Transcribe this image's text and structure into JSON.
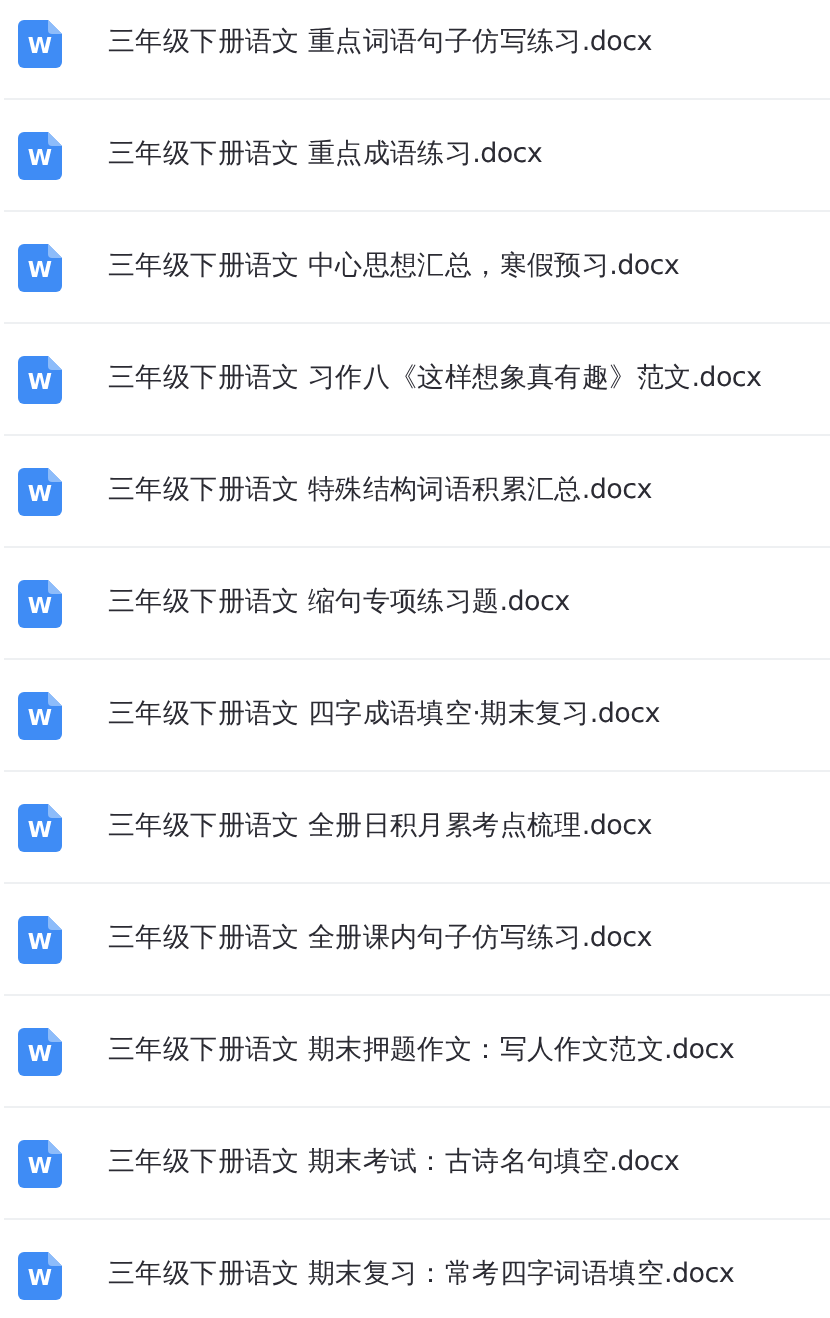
{
  "files": [
    {
      "icon_label": "W",
      "name": "三年级下册语文 重点词语句子仿写练习.docx"
    },
    {
      "icon_label": "W",
      "name": "三年级下册语文 重点成语练习.docx"
    },
    {
      "icon_label": "W",
      "name": "三年级下册语文 中心思想汇总，寒假预习.docx"
    },
    {
      "icon_label": "W",
      "name": "三年级下册语文 习作八《这样想象真有趣》范文.docx"
    },
    {
      "icon_label": "W",
      "name": "三年级下册语文 特殊结构词语积累汇总.docx"
    },
    {
      "icon_label": "W",
      "name": "三年级下册语文 缩句专项练习题.docx"
    },
    {
      "icon_label": "W",
      "name": "三年级下册语文 四字成语填空·期末复习.docx"
    },
    {
      "icon_label": "W",
      "name": "三年级下册语文 全册日积月累考点梳理.docx"
    },
    {
      "icon_label": "W",
      "name": "三年级下册语文 全册课内句子仿写练习.docx"
    },
    {
      "icon_label": "W",
      "name": "三年级下册语文 期末押题作文：写人作文范文.docx"
    },
    {
      "icon_label": "W",
      "name": "三年级下册语文 期末考试：古诗名句填空.docx"
    },
    {
      "icon_label": "W",
      "name": "三年级下册语文 期末复习：常考四字词语填空.docx"
    }
  ]
}
